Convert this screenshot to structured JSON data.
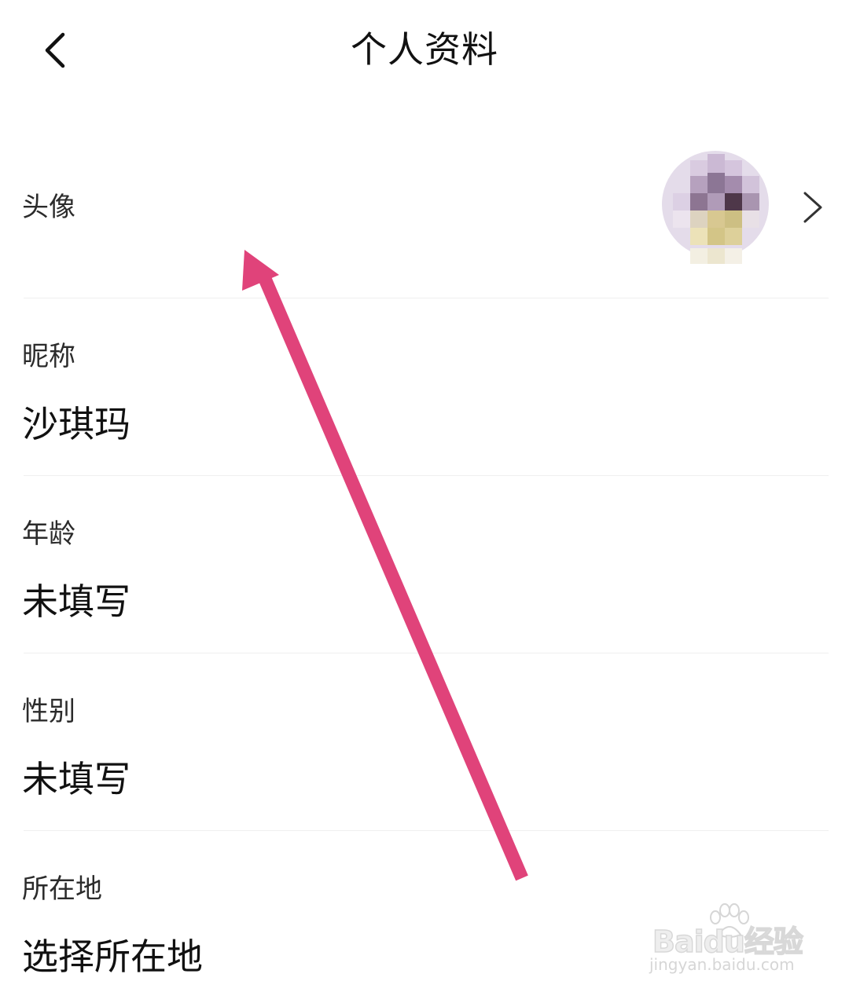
{
  "header": {
    "title": "个人资料",
    "back_icon": "chevron-left-icon"
  },
  "profile": {
    "avatar": {
      "label": "头像",
      "image": "pixelated-avatar",
      "chevron_icon": "chevron-right-icon"
    },
    "nickname": {
      "label": "昵称",
      "value": "沙琪玛"
    },
    "age": {
      "label": "年龄",
      "value": "未填写"
    },
    "gender": {
      "label": "性别",
      "value": "未填写"
    },
    "location": {
      "label": "所在地",
      "value": "选择所在地"
    }
  },
  "annotation": {
    "color": "#e0437a",
    "shape": "arrow"
  },
  "watermark": {
    "brand": "Baidu经验",
    "url": "jingyan.baidu.com"
  }
}
